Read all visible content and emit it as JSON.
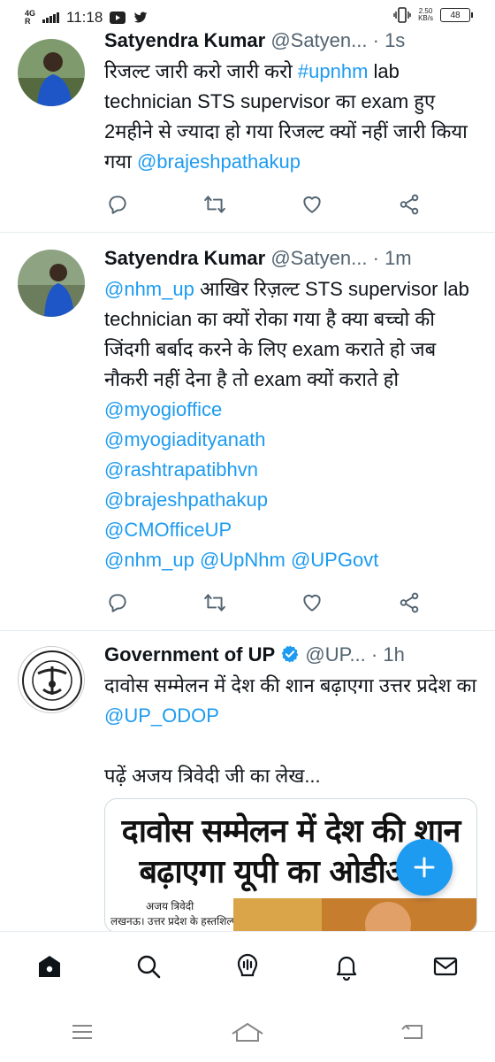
{
  "status_bar": {
    "network": "4G",
    "sim": "R",
    "time": "11:18",
    "net_speed_value": "2.50",
    "net_speed_unit": "KB/s",
    "battery": "48"
  },
  "tweets": [
    {
      "name": "Satyendra Kumar",
      "handle": "@Satyen...",
      "time": "1s",
      "segments": [
        {
          "text": "रिजल्ट जारी करो जारी करो ",
          "link": false
        },
        {
          "text": "#upnhm",
          "link": true
        },
        {
          "text": " lab technician STS supervisor का exam हुए 2महीने से ज्यादा हो गया रिजल्ट क्यों नहीं जारी किया गया ",
          "link": false
        },
        {
          "text": "@brajeshpathakup",
          "link": true
        }
      ]
    },
    {
      "name": "Satyendra Kumar",
      "handle": "@Satyen...",
      "time": "1m",
      "segments": [
        {
          "text": "@nhm_up",
          "link": true
        },
        {
          "text": " आखिर रिज़ल्ट STS supervisor lab technician का क्यों रोका गया है क्या बच्चो की जिंदगी बर्बाद करने के लिए exam कराते हो जब नौकरी नहीं देना है तो exam क्यों कराते हो  ",
          "link": false
        },
        {
          "text": "@myogioffice",
          "link": true
        },
        {
          "text": "@myogiadityanath",
          "link": true
        },
        {
          "text": "@rashtrapatibhvn",
          "link": true
        },
        {
          "text": "@brajeshpathakup",
          "link": true
        },
        {
          "text": "@CMOfficeUP",
          "link": true
        },
        {
          "text": "@nhm_up @UpNhm @UPGovt",
          "link": true
        }
      ]
    },
    {
      "name": "Government of UP",
      "handle": "@UP...",
      "time": "1h",
      "line1": "दावोस सम्मेलन में देश की शान बढ़ाएगा उत्तर प्रदेश का ",
      "link1": "@UP_ODOP",
      "line2": "पढ़ें अजय त्रिवेदी जी का लेख...",
      "card": {
        "headline_1": "दावोस सम्मेलन में देश की शान",
        "headline_2": "बढ़ाएगा यूपी का ओडीओपी",
        "byline": "अजय त्रिवेदी",
        "dateline": "लखनऊ। उत्तर प्रदेश के हस्तशिल्प"
      }
    }
  ],
  "icons": {
    "reply": "reply-icon",
    "retweet": "retweet-icon",
    "like": "like-icon",
    "share": "share-icon",
    "compose": "plus-icon"
  },
  "colors": {
    "accent": "#1d9bf0",
    "text": "#0f1419",
    "muted": "#536471"
  }
}
